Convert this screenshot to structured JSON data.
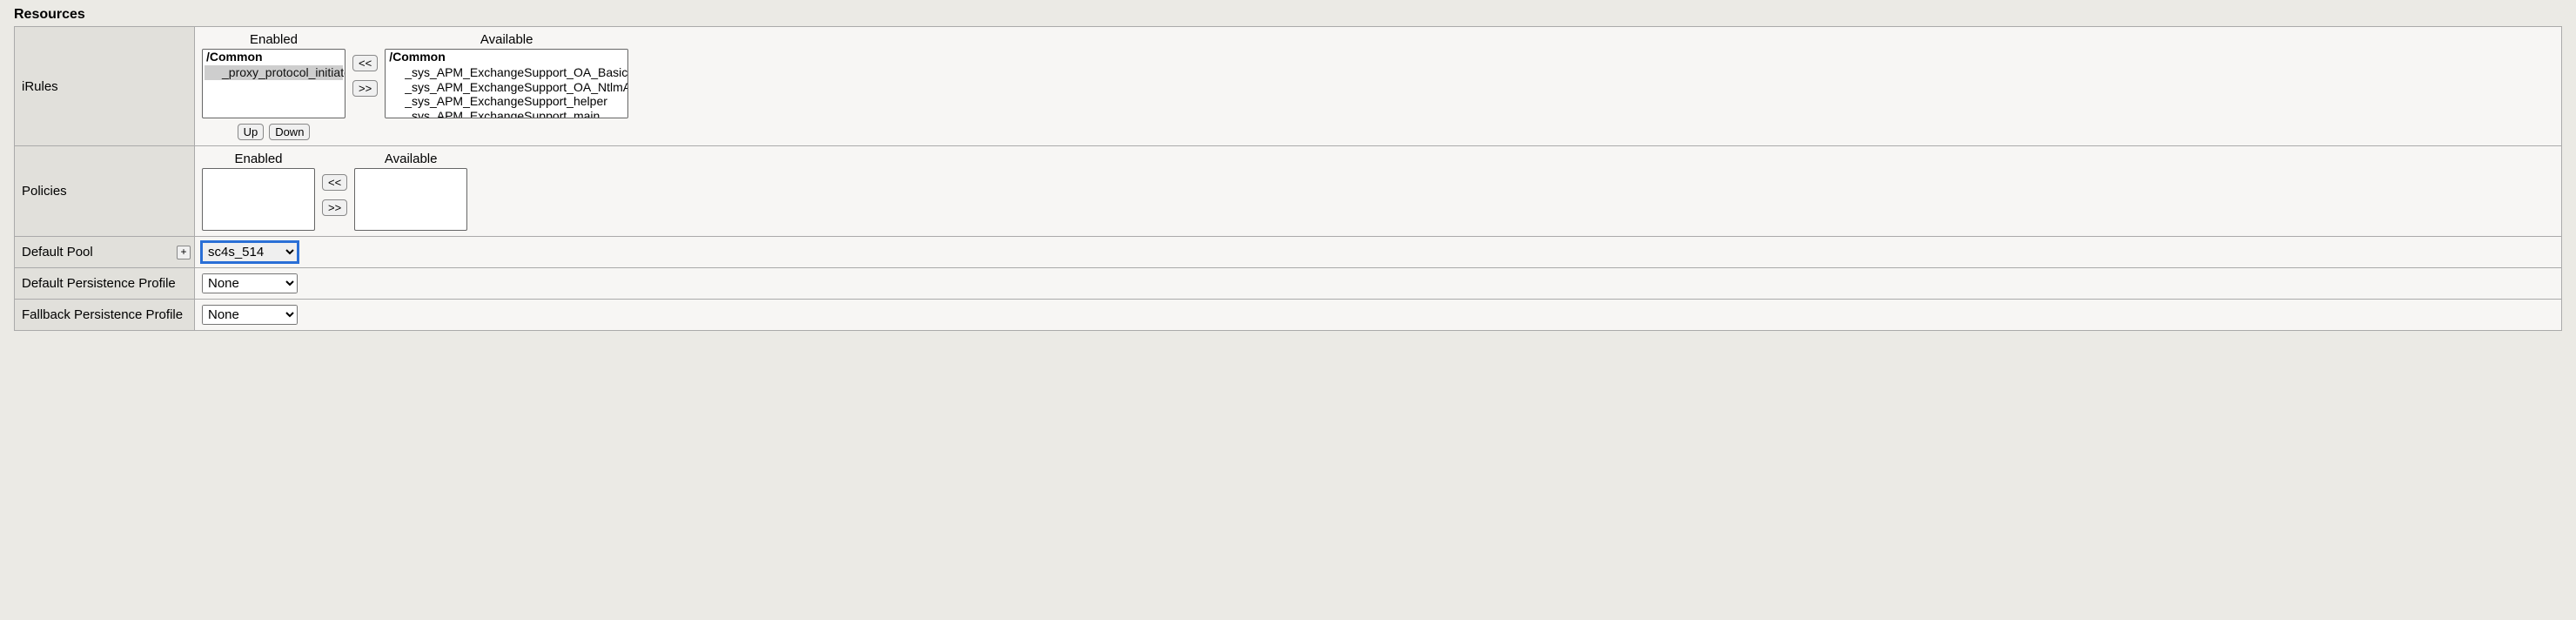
{
  "section_title": "Resources",
  "irules": {
    "label": "iRules",
    "enabled_label": "Enabled",
    "available_label": "Available",
    "group_label": "/Common",
    "enabled_items": [
      "_proxy_protocol_initiator"
    ],
    "available_items": [
      "_sys_APM_ExchangeSupport_OA_BasicAuth",
      "_sys_APM_ExchangeSupport_OA_NtlmAuth",
      "_sys_APM_ExchangeSupport_helper",
      "_sys_APM_ExchangeSupport_main"
    ],
    "btn_left": "<<",
    "btn_right": ">>",
    "btn_up": "Up",
    "btn_down": "Down"
  },
  "policies": {
    "label": "Policies",
    "enabled_label": "Enabled",
    "available_label": "Available",
    "btn_left": "<<",
    "btn_right": ">>"
  },
  "default_pool": {
    "label": "Default Pool",
    "plus": "+",
    "value": "sc4s_514",
    "options": [
      "sc4s_514"
    ]
  },
  "default_persistence": {
    "label": "Default Persistence Profile",
    "value": "None",
    "options": [
      "None"
    ]
  },
  "fallback_persistence": {
    "label": "Fallback Persistence Profile",
    "value": "None",
    "options": [
      "None"
    ]
  }
}
